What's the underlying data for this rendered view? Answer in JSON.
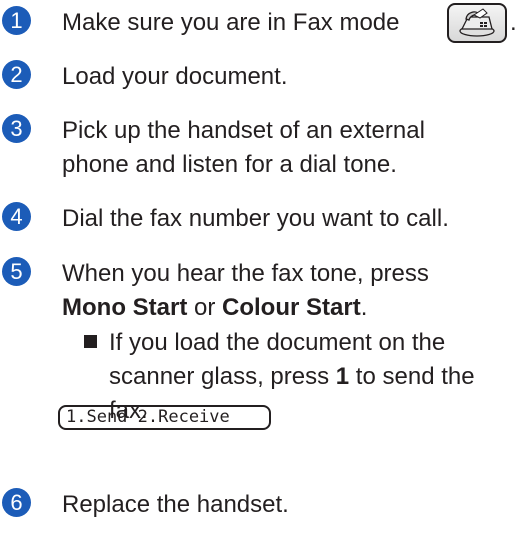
{
  "steps": [
    {
      "number": "1",
      "text": "Make sure you are in Fax mode",
      "suffix": "."
    },
    {
      "number": "2",
      "text": "Load your document."
    },
    {
      "number": "3",
      "line1": "Pick up the handset of an external",
      "line2": "phone and listen for a dial tone."
    },
    {
      "number": "4",
      "text": "Dial the fax number you want to call."
    },
    {
      "number": "5",
      "line1": "When you hear the fax tone, press",
      "bold1": "Mono Start",
      "or_text": " or ",
      "bold2": "Colour Start",
      "end": ".",
      "bullet": {
        "pre": "If you load the document on the",
        "line2_pre": "scanner glass, press ",
        "bold": "1",
        "line2_post": " to send the",
        "line3": "fax."
      }
    },
    {
      "number": "6",
      "text": "Replace the handset."
    }
  ],
  "lcd_display": "1.Send 2.Receive",
  "icons": {
    "fax_mode": "fax-machine-icon"
  },
  "colors": {
    "accent": "#1c5cb8",
    "text": "#231f20"
  }
}
